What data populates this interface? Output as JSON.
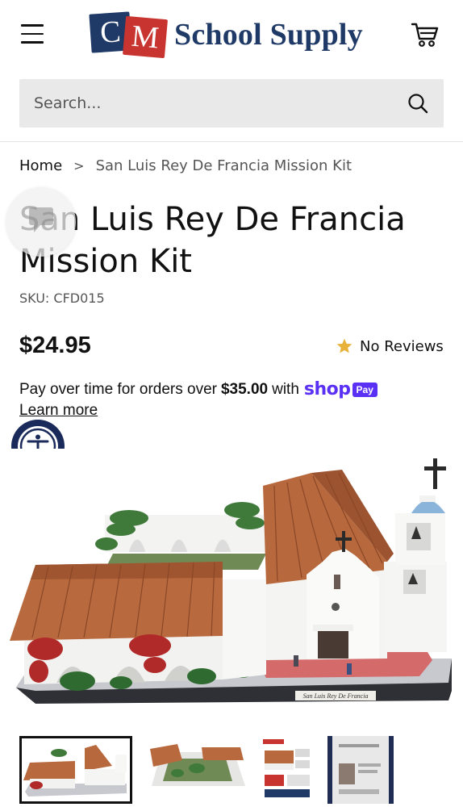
{
  "header": {
    "logo_c": "C",
    "logo_m": "M",
    "logo_text": "School Supply",
    "menu_icon": "hamburger-menu-icon",
    "cart_icon": "shopping-cart-icon",
    "brand_colors": {
      "navy": "#1f3a66",
      "red": "#c8342f"
    }
  },
  "search": {
    "placeholder": "Search...",
    "icon": "search-icon"
  },
  "breadcrumb": {
    "home": "Home",
    "separator": ">",
    "current": "San Luis Rey De Francia Mission Kit"
  },
  "product": {
    "title": "San Luis Rey De Francia Mission Kit",
    "sku": "SKU: CFD015",
    "price": "$24.95",
    "reviews": "No Reviews",
    "star_color": "#e8b23a"
  },
  "payment": {
    "text_before": "Pay over time for orders over",
    "amount": "$35.00",
    "text_after": "with",
    "shop_word": "shop",
    "pay_badge": "Pay",
    "learn_more": "Learn more",
    "shop_pay_color": "#5a31f4"
  },
  "image": {
    "plaque_text": "San Luis Rey De Francia"
  },
  "thumbnails": {
    "selected_index": 0,
    "count": 4
  }
}
